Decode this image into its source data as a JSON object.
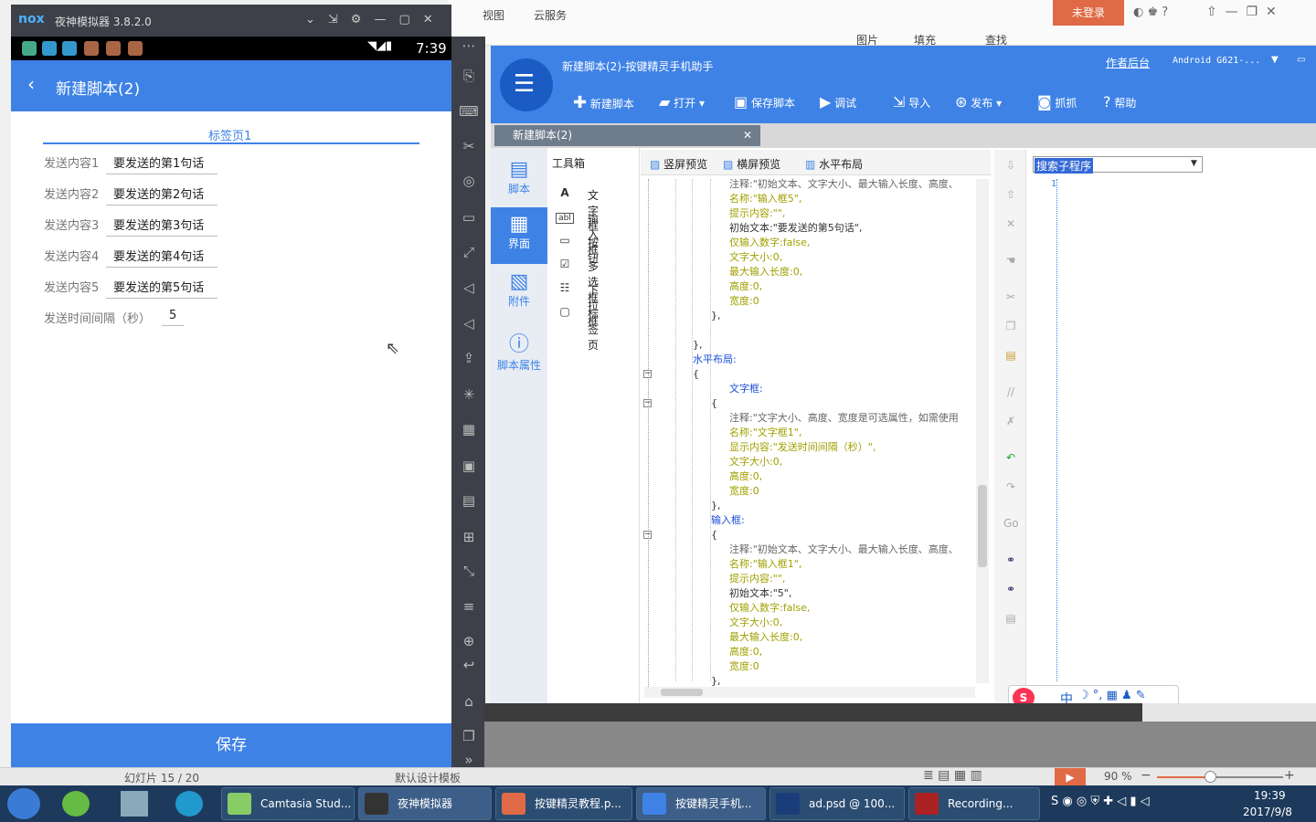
{
  "ppt": {
    "tabs": [
      "视图",
      "云服务"
    ],
    "unlogin": "未登录",
    "tools": [
      "图片",
      "填充",
      "查找"
    ],
    "slide_info": "幻灯片 15 / 20",
    "template": "默认设计模板",
    "zoom": "90 %"
  },
  "nox": {
    "title": "夜神模拟器 3.8.2.0",
    "time": "7:39"
  },
  "phone": {
    "header_title": "新建脚本(2)",
    "tab_label": "标签页1",
    "rows": [
      {
        "label": "发送内容1",
        "value": "要发送的第1句话"
      },
      {
        "label": "发送内容2",
        "value": "要发送的第2句话"
      },
      {
        "label": "发送内容3",
        "value": "要发送的第3句话"
      },
      {
        "label": "发送内容4",
        "value": "要发送的第4句话"
      },
      {
        "label": "发送内容5",
        "value": "要发送的第5句话"
      }
    ],
    "interval_label": "发送时间间隔（秒）",
    "interval_value": "5",
    "save_label": "保存"
  },
  "assistant": {
    "title": "新建脚本(2)-按键精灵手机助手",
    "author_link": "作者后台",
    "device": "Android  G621-...",
    "toolbar": {
      "new": "新建脚本",
      "open": "打开",
      "save": "保存脚本",
      "debug": "调试",
      "import": "导入",
      "publish": "发布",
      "capture": "抓抓",
      "help": "帮助"
    },
    "tab": "新建脚本(2)",
    "nav": {
      "script": "脚本",
      "ui": "界面",
      "attach": "附件",
      "props": "脚本属性"
    },
    "toolbox_title": "工具箱",
    "toolbox": [
      "文字框",
      "输入框",
      "按钮",
      "多选框",
      "下拉框",
      "标签页"
    ],
    "preview": {
      "portrait": "竖屏预览",
      "landscape": "横屏预览",
      "hlayout": "水平布局"
    },
    "code": {
      "l1": "注释:\"初始文本、文字大小、最大输入长度、高度、",
      "l2": "名称:\"输入框5\",",
      "l3": "提示内容:\"\",",
      "l4": "初始文本:\"要发送的第5句话\",",
      "l5": "仅输入数字:false,",
      "l6": "文字大小:0,",
      "l7": "最大输入长度:0,",
      "l8": "高度:0,",
      "l9": "宽度:0",
      "l10": "},",
      "l11": "},",
      "l12": "水平布局:",
      "l13": "{",
      "l14": "文字框:",
      "l15": "{",
      "l16": "注释:\"文字大小、高度、宽度是可选属性，如需使用",
      "l17": "名称:\"文字框1\",",
      "l18": "显示内容:\"发送时间间隔（秒）\",",
      "l19": "文字大小:0,",
      "l20": "高度:0,",
      "l21": "宽度:0",
      "l22": "},",
      "l23": "输入框:",
      "l24": "{",
      "l25": "注释:\"初始文本、文字大小、最大输入长度、高度、",
      "l26": "名称:\"输入框1\",",
      "l27": "提示内容:\"\",",
      "l28": "初始文本:\"5\",",
      "l29": "仅输入数字:false,",
      "l30": "文字大小:0,",
      "l31": "最大输入长度:0,",
      "l32": "高度:0,",
      "l33": "宽度:0",
      "l34": "},"
    },
    "search_placeholder": "搜索子程序",
    "line_no": "1"
  },
  "ime": "中",
  "taskbar": {
    "items": [
      "Camtasia Stud...",
      "夜神模拟器",
      "按键精灵教程.p...",
      "按键精灵手机...",
      "ad.psd @ 100...",
      "Recording..."
    ],
    "time": "19:39",
    "date": "2017/9/8"
  }
}
